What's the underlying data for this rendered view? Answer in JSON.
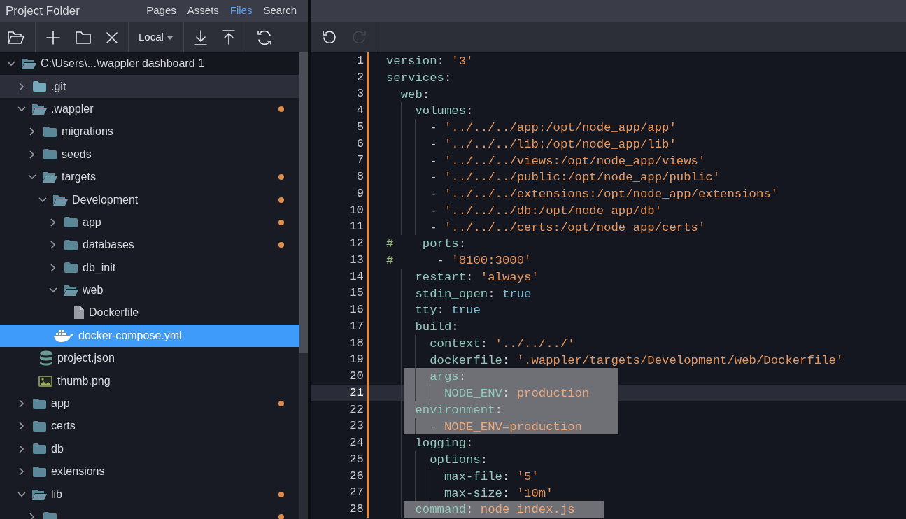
{
  "sidebar": {
    "title": "Project Folder",
    "tabs": [
      {
        "label": "Pages",
        "selected": false
      },
      {
        "label": "Assets",
        "selected": false
      },
      {
        "label": "Files",
        "selected": true
      },
      {
        "label": "Search",
        "selected": false
      }
    ],
    "toolbar": [
      {
        "kind": "open"
      },
      {
        "kind": "sep"
      },
      {
        "kind": "add"
      },
      {
        "kind": "folder"
      },
      {
        "kind": "delete"
      },
      {
        "kind": "sep"
      },
      {
        "kind": "dropdown",
        "label": "Local"
      },
      {
        "kind": "sep"
      },
      {
        "kind": "download"
      },
      {
        "kind": "upload"
      },
      {
        "kind": "sep"
      },
      {
        "kind": "refresh"
      }
    ],
    "tree": [
      {
        "label": "C:\\Users\\...\\wappler dashboard 1",
        "kind": "root",
        "expanded": true,
        "modified": false,
        "selected": false,
        "hovered": false,
        "children": [
          {
            "label": ".git",
            "kind": "folder",
            "expanded": false,
            "modified": false,
            "selected": false,
            "hovered": true
          },
          {
            "label": ".wappler",
            "kind": "folder",
            "expanded": true,
            "modified": true,
            "selected": false,
            "hovered": false,
            "children": [
              {
                "label": "migrations",
                "kind": "folder",
                "expanded": false,
                "modified": false,
                "selected": false,
                "hovered": false
              },
              {
                "label": "seeds",
                "kind": "folder",
                "expanded": false,
                "modified": false,
                "selected": false,
                "hovered": false
              },
              {
                "label": "targets",
                "kind": "folder",
                "expanded": true,
                "modified": true,
                "selected": false,
                "hovered": false,
                "children": [
                  {
                    "label": "Development",
                    "kind": "folder",
                    "expanded": true,
                    "modified": true,
                    "selected": false,
                    "hovered": false,
                    "children": [
                      {
                        "label": "app",
                        "kind": "folder",
                        "expanded": false,
                        "modified": true,
                        "selected": false,
                        "hovered": false
                      },
                      {
                        "label": "databases",
                        "kind": "folder",
                        "expanded": false,
                        "modified": true,
                        "selected": false,
                        "hovered": false
                      },
                      {
                        "label": "db_init",
                        "kind": "folder",
                        "expanded": false,
                        "modified": false,
                        "selected": false,
                        "hovered": false
                      },
                      {
                        "label": "web",
                        "kind": "folder",
                        "expanded": true,
                        "modified": false,
                        "selected": false,
                        "hovered": false,
                        "children": [
                          {
                            "label": "Dockerfile",
                            "kind": "file",
                            "modified": false,
                            "selected": false,
                            "hovered": false
                          }
                        ]
                      },
                      {
                        "label": "docker-compose.yml",
                        "kind": "docker",
                        "modified": false,
                        "selected": true,
                        "hovered": false
                      }
                    ]
                  }
                ]
              },
              {
                "label": "project.json",
                "kind": "database",
                "modified": false,
                "selected": false,
                "hovered": false
              },
              {
                "label": "thumb.png",
                "kind": "image",
                "modified": false,
                "selected": false,
                "hovered": false
              }
            ]
          },
          {
            "label": "app",
            "kind": "folder",
            "expanded": false,
            "modified": true,
            "selected": false,
            "hovered": false
          },
          {
            "label": "certs",
            "kind": "folder",
            "expanded": false,
            "modified": false,
            "selected": false,
            "hovered": false
          },
          {
            "label": "db",
            "kind": "folder",
            "expanded": false,
            "modified": false,
            "selected": false,
            "hovered": false
          },
          {
            "label": "extensions",
            "kind": "folder",
            "expanded": false,
            "modified": false,
            "selected": false,
            "hovered": false
          },
          {
            "label": "lib",
            "kind": "folder",
            "expanded": true,
            "modified": true,
            "selected": false,
            "hovered": false,
            "children": [
              {
                "kind": "folder",
                "expanded": false,
                "modified": true,
                "selected": false,
                "hovered": false
              }
            ]
          }
        ]
      }
    ]
  },
  "editor": {
    "toolbar": [
      {
        "kind": "undo",
        "disabled": false
      },
      {
        "kind": "redo",
        "disabled": true
      }
    ],
    "lines": [
      {
        "n": "1",
        "selected": false,
        "current": false,
        "tokens": [
          {
            "kind": "key",
            "text": "version"
          },
          {
            "kind": "punct",
            "text": ": "
          },
          {
            "kind": "str",
            "text": "'3'"
          }
        ]
      },
      {
        "n": "2",
        "selected": false,
        "current": false,
        "tokens": [
          {
            "kind": "key",
            "text": "services"
          },
          {
            "kind": "punct",
            "text": ":"
          }
        ],
        "children": [
          {
            "n": "3",
            "selected": false,
            "current": false,
            "tokens": [
              {
                "kind": "key",
                "text": "web"
              },
              {
                "kind": "punct",
                "text": ":"
              }
            ],
            "children": [
              {
                "n": "4",
                "selected": false,
                "current": false,
                "tokens": [
                  {
                    "kind": "key",
                    "text": "volumes"
                  },
                  {
                    "kind": "punct",
                    "text": ":"
                  }
                ],
                "children": [
                  {
                    "n": "5",
                    "selected": false,
                    "current": false,
                    "tokens": [
                      {
                        "kind": "punct",
                        "text": "- "
                      },
                      {
                        "kind": "str",
                        "text": "'../../../app:/opt/node_app/app'"
                      }
                    ]
                  },
                  {
                    "n": "6",
                    "selected": false,
                    "current": false,
                    "tokens": [
                      {
                        "kind": "punct",
                        "text": "- "
                      },
                      {
                        "kind": "str",
                        "text": "'../../../lib:/opt/node_app/lib'"
                      }
                    ]
                  },
                  {
                    "n": "7",
                    "selected": false,
                    "current": false,
                    "tokens": [
                      {
                        "kind": "punct",
                        "text": "- "
                      },
                      {
                        "kind": "str",
                        "text": "'../../../views:/opt/node_app/views'"
                      }
                    ]
                  },
                  {
                    "n": "8",
                    "selected": false,
                    "current": false,
                    "tokens": [
                      {
                        "kind": "punct",
                        "text": "- "
                      },
                      {
                        "kind": "str",
                        "text": "'../../../public:/opt/node_app/public'"
                      }
                    ]
                  },
                  {
                    "n": "9",
                    "selected": false,
                    "current": false,
                    "tokens": [
                      {
                        "kind": "punct",
                        "text": "- "
                      },
                      {
                        "kind": "str",
                        "text": "'../../../extensions:/opt/node_app/extensions'"
                      }
                    ]
                  },
                  {
                    "n": "10",
                    "selected": false,
                    "current": false,
                    "tokens": [
                      {
                        "kind": "punct",
                        "text": "- "
                      },
                      {
                        "kind": "str",
                        "text": "'../../../db:/opt/node_app/db'"
                      }
                    ]
                  },
                  {
                    "n": "11",
                    "selected": false,
                    "current": false,
                    "tokens": [
                      {
                        "kind": "punct",
                        "text": "- "
                      },
                      {
                        "kind": "str",
                        "text": "'../../../certs:/opt/node_app/certs'"
                      }
                    ]
                  }
                ]
              },
              {
                "n": "12",
                "selected": false,
                "current": false,
                "tokens": [
                  {
                    "kind": "comment",
                    "text": "#"
                  },
                  {
                    "kind": "key",
                    "text": "    ports"
                  },
                  {
                    "kind": "punct",
                    "text": ":"
                  }
                ]
              },
              {
                "n": "13",
                "selected": false,
                "current": false,
                "tokens": [
                  {
                    "kind": "comment",
                    "text": "#"
                  },
                  {
                    "kind": "punct",
                    "text": "      - "
                  },
                  {
                    "kind": "str",
                    "text": "'8100:3000'"
                  }
                ]
              },
              {
                "n": "14",
                "selected": false,
                "current": false,
                "tokens": [
                  {
                    "kind": "key",
                    "text": "restart"
                  },
                  {
                    "kind": "punct",
                    "text": ": "
                  },
                  {
                    "kind": "str",
                    "text": "'always'"
                  }
                ]
              },
              {
                "n": "15",
                "selected": false,
                "current": false,
                "tokens": [
                  {
                    "kind": "key",
                    "text": "stdin_open"
                  },
                  {
                    "kind": "punct",
                    "text": ": "
                  },
                  {
                    "kind": "kw",
                    "text": "true"
                  }
                ]
              },
              {
                "n": "16",
                "selected": false,
                "current": false,
                "tokens": [
                  {
                    "kind": "key",
                    "text": "tty"
                  },
                  {
                    "kind": "punct",
                    "text": ": "
                  },
                  {
                    "kind": "kw",
                    "text": "true"
                  }
                ]
              },
              {
                "n": "17",
                "selected": false,
                "current": false,
                "tokens": [
                  {
                    "kind": "key",
                    "text": "build"
                  },
                  {
                    "kind": "punct",
                    "text": ":"
                  }
                ],
                "children": [
                  {
                    "n": "18",
                    "selected": false,
                    "current": false,
                    "tokens": [
                      {
                        "kind": "key",
                        "text": "context"
                      },
                      {
                        "kind": "punct",
                        "text": ": "
                      },
                      {
                        "kind": "str",
                        "text": "'../../../'"
                      }
                    ]
                  },
                  {
                    "n": "19",
                    "selected": false,
                    "current": false,
                    "tokens": [
                      {
                        "kind": "key",
                        "text": "dockerfile"
                      },
                      {
                        "kind": "punct",
                        "text": ": "
                      },
                      {
                        "kind": "str",
                        "text": "'.wappler/targets/Development/web/Dockerfile'"
                      }
                    ]
                  },
                  {
                    "n": "20",
                    "selected": true,
                    "current": false,
                    "tokens": [
                      {
                        "kind": "key",
                        "text": "args"
                      },
                      {
                        "kind": "punct",
                        "text": ":"
                      }
                    ],
                    "children": [
                      {
                        "n": "21",
                        "selected": true,
                        "current": true,
                        "tokens": [
                          {
                            "kind": "key",
                            "text": "NODE_ENV"
                          },
                          {
                            "kind": "punct",
                            "text": ": "
                          },
                          {
                            "kind": "val",
                            "text": "production"
                          }
                        ]
                      }
                    ]
                  }
                ]
              },
              {
                "n": "22",
                "selected": true,
                "current": false,
                "tokens": [
                  {
                    "kind": "key",
                    "text": "environment"
                  },
                  {
                    "kind": "punct",
                    "text": ":"
                  }
                ],
                "children": [
                  {
                    "n": "23",
                    "selected": true,
                    "current": false,
                    "tokens": [
                      {
                        "kind": "punct",
                        "text": "- "
                      },
                      {
                        "kind": "val",
                        "text": "NODE_ENV=production"
                      }
                    ]
                  }
                ]
              },
              {
                "n": "24",
                "selected": false,
                "current": false,
                "tokens": [
                  {
                    "kind": "key",
                    "text": "logging"
                  },
                  {
                    "kind": "punct",
                    "text": ":"
                  }
                ],
                "children": [
                  {
                    "n": "25",
                    "selected": false,
                    "current": false,
                    "tokens": [
                      {
                        "kind": "key",
                        "text": "options"
                      },
                      {
                        "kind": "punct",
                        "text": ":"
                      }
                    ],
                    "children": [
                      {
                        "n": "26",
                        "selected": false,
                        "current": false,
                        "tokens": [
                          {
                            "kind": "key",
                            "text": "max-file"
                          },
                          {
                            "kind": "punct",
                            "text": ": "
                          },
                          {
                            "kind": "str",
                            "text": "'5'"
                          }
                        ]
                      },
                      {
                        "n": "27",
                        "selected": false,
                        "current": false,
                        "tokens": [
                          {
                            "kind": "key",
                            "text": "max-size"
                          },
                          {
                            "kind": "punct",
                            "text": ": "
                          },
                          {
                            "kind": "str",
                            "text": "'10m'"
                          }
                        ]
                      }
                    ]
                  }
                ]
              },
              {
                "n": "28",
                "selected": true,
                "current": false,
                "tokens": [
                  {
                    "kind": "key",
                    "text": "command"
                  },
                  {
                    "kind": "punct",
                    "text": ": "
                  },
                  {
                    "kind": "val",
                    "text": "node index.js"
                  }
                ]
              }
            ]
          }
        ]
      }
    ]
  }
}
